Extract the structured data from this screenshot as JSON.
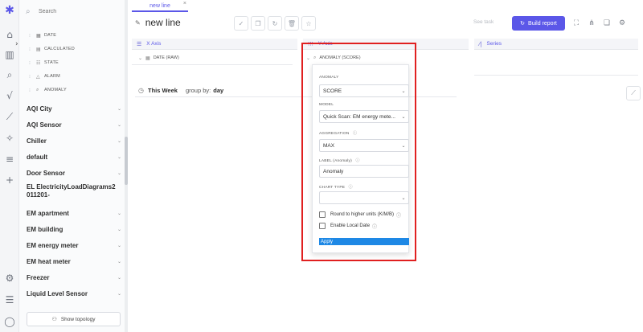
{
  "rail": {
    "icons": [
      "logo-icon",
      "home-icon",
      "expand-icon",
      "chart-icon",
      "search-icon",
      "formula-icon",
      "trend-icon",
      "sparkle-icon",
      "menu-icon",
      "plus-icon",
      "settings-icon",
      "sliders-icon",
      "user-icon"
    ]
  },
  "sidebar": {
    "search_placeholder": "Search",
    "sub_items": [
      {
        "label": "DATE",
        "icon": "calendar-icon"
      },
      {
        "label": "CALCULATED",
        "icon": "table-icon"
      },
      {
        "label": "STATE",
        "icon": "list-icon"
      },
      {
        "label": "ALARM",
        "icon": "bell-icon"
      },
      {
        "label": "ANOMALY",
        "icon": "magnifier-icon"
      }
    ],
    "groups": [
      "AQI City",
      "AQI Sensor",
      "Chiller",
      "default",
      "Door Sensor",
      "EL ElectricityLoadDiagrams2011201-",
      "EM apartment",
      "EM building",
      "EM energy meter",
      "EM heat meter",
      "Freezer",
      "Liquid Level Sensor"
    ],
    "topology_label": "Show topology"
  },
  "header": {
    "tab_label": "new line",
    "title": "new line",
    "see_task": "See task",
    "build_report": "Build report"
  },
  "axes": {
    "x_axis_label": "X Axis",
    "y_axis_label": "Y Axis",
    "series_label": "Series",
    "x_sub": "DATE (RAW)",
    "y_sub": "ANOMALY (SCORE)"
  },
  "range": {
    "period": "This Week",
    "group_by_label": "group by:",
    "group_by_value": "day"
  },
  "popup": {
    "anomaly_label": "ANOMALY",
    "anomaly_value": "SCORE",
    "model_label": "MODEL",
    "model_value": "Quick Scan: EM energy mete...",
    "aggregation_label": "AGGREGATION",
    "aggregation_value": "MAX",
    "label_label": "LABEL (Anomaly)",
    "label_value": "Anomaly",
    "chart_type_label": "CHART TYPE",
    "chart_type_value": "",
    "round_label": "Round to higher units (K/M/B)",
    "local_date_label": "Enable Local Date",
    "apply_label": "Apply"
  },
  "colors": {
    "accent": "#5b57e8",
    "highlight": "#e02020",
    "apply": "#1e88e5"
  }
}
